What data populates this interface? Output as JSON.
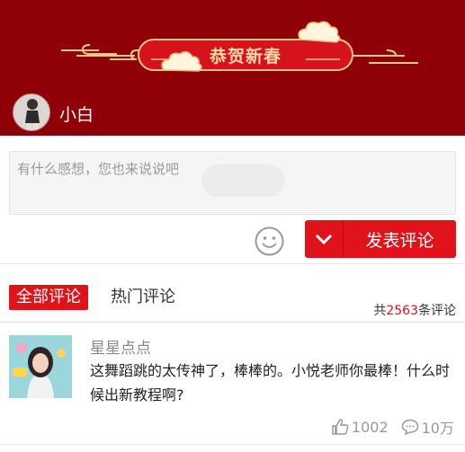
{
  "header": {
    "banner_title": "恭贺新春",
    "user": {
      "name": "小白"
    }
  },
  "composer": {
    "placeholder": "有什么感想，您也来说说吧",
    "publish_label": "发表评论",
    "emoji_icon": "smiley-icon",
    "toggle_icon": "chevron-down-icon"
  },
  "tabs": {
    "all": "全部评论",
    "hot": "热门评论"
  },
  "count": {
    "prefix": "共",
    "number": "2563",
    "suffix": "条评论"
  },
  "comments": [
    {
      "author": "星星点点",
      "text": "这舞蹈跳的太传神了，棒棒的。小悦老师你最棒！什么时候出新教程啊?",
      "likes": "1002",
      "replies": "10万"
    }
  ],
  "colors": {
    "header_bg": "#8f0007",
    "accent": "#e0121b",
    "gold": "#ffd9a8"
  }
}
